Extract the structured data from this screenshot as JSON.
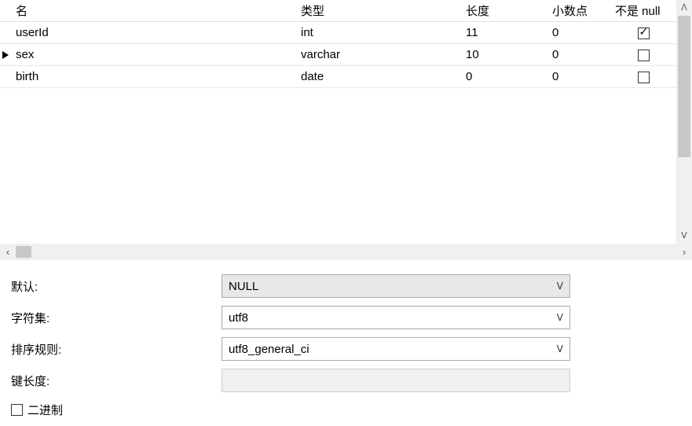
{
  "columns": {
    "name": "名",
    "type": "类型",
    "length": "长度",
    "decimal": "小数点",
    "notnull": "不是 null"
  },
  "rows": [
    {
      "name": "userId",
      "type": "int",
      "length": "11",
      "decimal": "0",
      "notnull": true,
      "selected": false
    },
    {
      "name": "sex",
      "type": "varchar",
      "length": "10",
      "decimal": "0",
      "notnull": false,
      "selected": true
    },
    {
      "name": "birth",
      "type": "date",
      "length": "0",
      "decimal": "0",
      "notnull": false,
      "selected": false
    }
  ],
  "props": {
    "default_label": "默认:",
    "default_value": "NULL",
    "charset_label": "字符集:",
    "charset_value": "utf8",
    "collation_label": "排序规则:",
    "collation_value": "utf8_general_ci",
    "keylen_label": "键长度:",
    "keylen_value": "",
    "binary_label": "二进制",
    "binary_value": false
  }
}
